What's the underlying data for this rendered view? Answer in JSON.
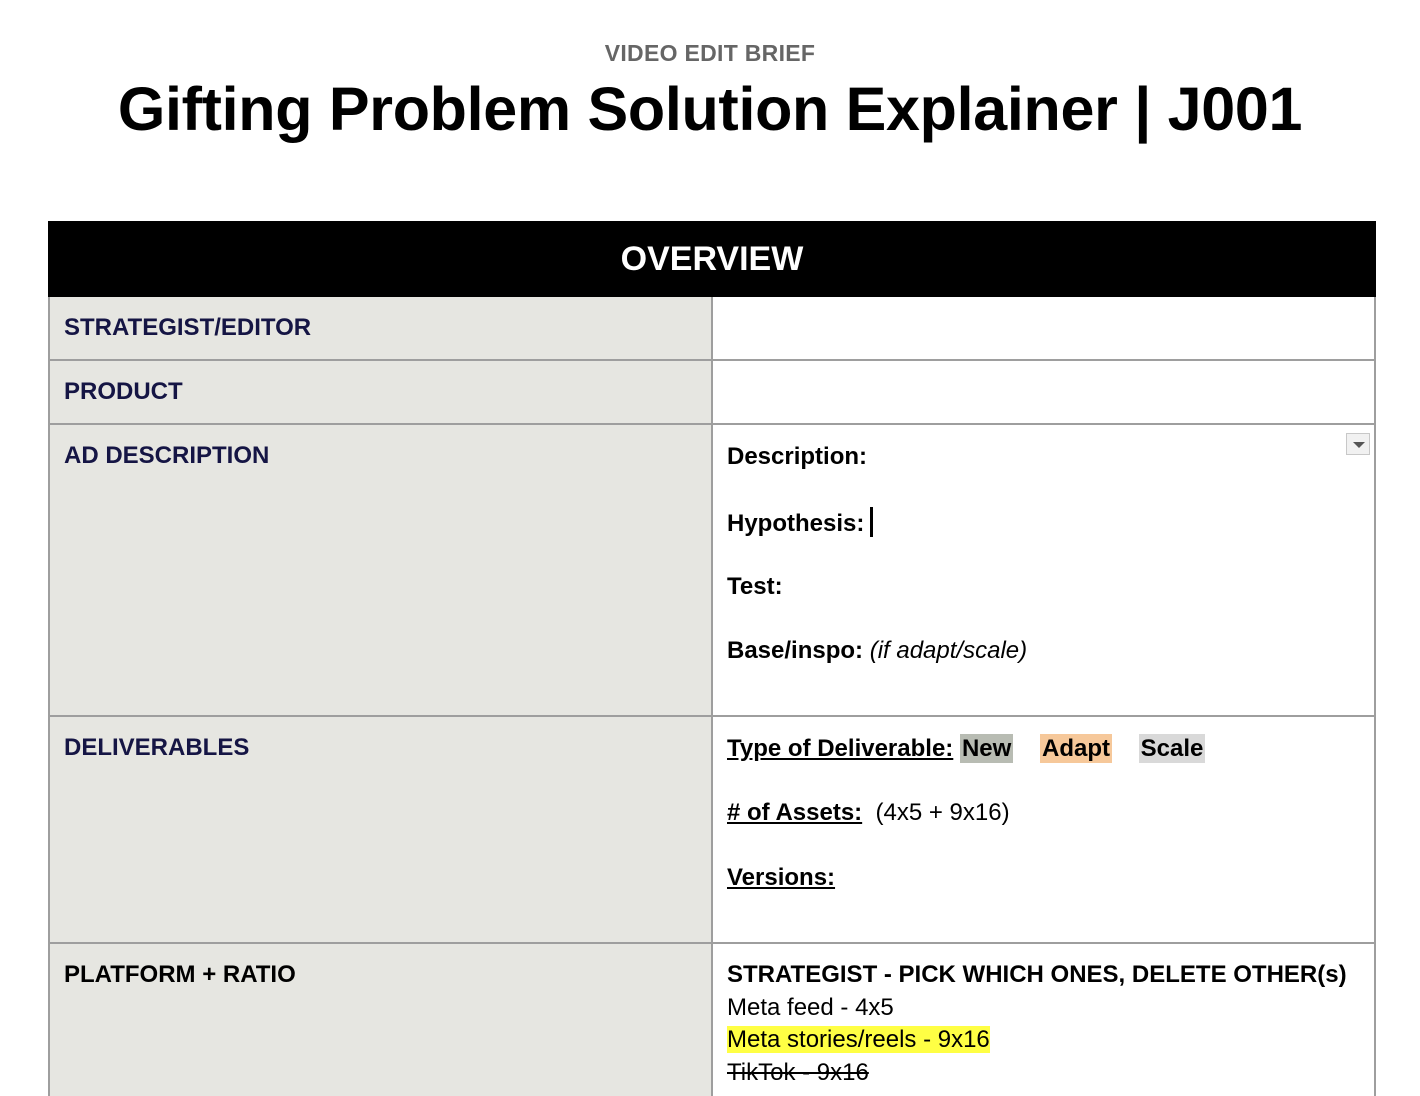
{
  "header": {
    "kicker": "VIDEO EDIT BRIEF",
    "title": "Gifting Problem Solution Explainer | J001"
  },
  "overview": {
    "heading": "OVERVIEW",
    "rows": {
      "strategist": {
        "label": "STRATEGIST/EDITOR",
        "value": ""
      },
      "product": {
        "label": "PRODUCT",
        "value": ""
      },
      "ad_description": {
        "label": "AD DESCRIPTION",
        "description_label": "Description:",
        "hypothesis_label": "Hypothesis:",
        "test_label": "Test:",
        "base_label": "Base/inspo:",
        "base_note": "(if adapt/scale)"
      },
      "deliverables": {
        "label": "DELIVERABLES",
        "type_label": "Type of Deliverable:",
        "options": [
          "New",
          "Adapt",
          "Scale"
        ],
        "option_colors": [
          "#b8bcb3",
          "#f6c89a",
          "#d9d9d9"
        ],
        "assets_label": "# of Assets:",
        "assets_value": "(4x5 + 9x16)",
        "versions_label": "Versions:"
      },
      "platform": {
        "label": "PLATFORM + RATIO",
        "instruction": "STRATEGIST - PICK WHICH ONES, DELETE OTHER(s)",
        "items": [
          {
            "text": "Meta feed - 4x5",
            "style": "plain"
          },
          {
            "text": "Meta stories/reels - 9x16",
            "style": "highlight"
          },
          {
            "text": "TikTok - 9x16",
            "style": "strikethrough"
          }
        ],
        "highlight_color": "#ffff44"
      }
    }
  }
}
